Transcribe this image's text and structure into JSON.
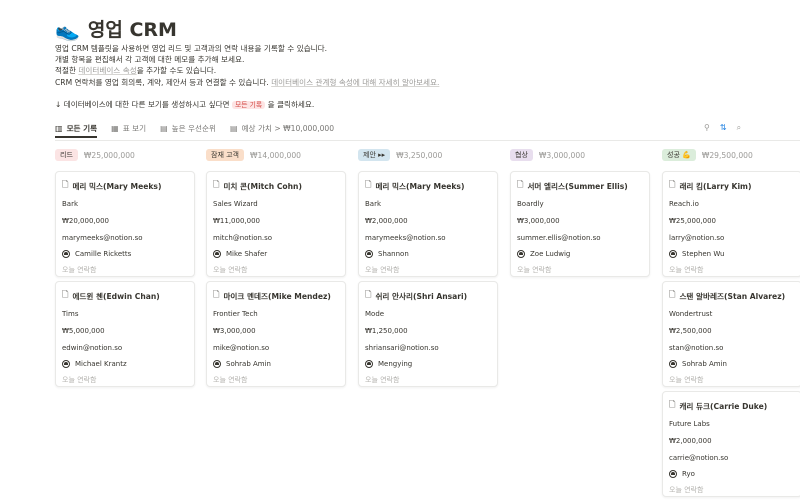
{
  "page": {
    "emoji": "👟",
    "title": "영업 CRM",
    "description_lines": [
      "영업 CRM 템플릿을 사용하면 영업 리드 및 고객과의 연락 내용을 기록할 수 있습니다.",
      "개별 항목을 편집해서 각 고객에 대한 메모를 추가해 보세요."
    ],
    "line3_pre": "적절한 ",
    "line3_link": "데이터베이스 속성",
    "line3_post": "을 추가할 수도 있습니다.",
    "line4_pre": "CRM 연락처를 영업 회의록, 계약, 제안서 등과 연결할 수 있습니다. ",
    "line4_link": "데이터베이스 관계형 속성에 대해 자세히 알아보세요.",
    "hint_pre": "↓ 데이터베이스에 대한 다른 보기를 생성하시고 싶다면 ",
    "hint_chip": "모든 기록",
    "hint_post": " 을 클릭하세요."
  },
  "views": [
    {
      "label": "모든 기록",
      "icon": "▥"
    },
    {
      "label": "표 보기",
      "icon": "▦"
    },
    {
      "label": "높은 우선순위",
      "icon": "▤"
    },
    {
      "label": "예상 가치 > ₩10,000,000",
      "icon": "▤"
    }
  ],
  "tools": {
    "filter": "⚲",
    "sort": "⇅",
    "search": "⌕"
  },
  "columns": [
    {
      "label": "리드",
      "color": "#fbe4e4",
      "total": "₩25,000,000",
      "cards": [
        {
          "name": "메리 믹스(Mary Meeks)",
          "company": "Bark",
          "value": "₩20,000,000",
          "email": "marymeeks@notion.so",
          "owner": "Camille Ricketts",
          "contact": "오늘 연락함"
        },
        {
          "name": "에드윈 첸(Edwin Chan)",
          "company": "Tims",
          "value": "₩5,000,000",
          "email": "edwin@notion.so",
          "owner": "Michael Krantz",
          "contact": "오늘 연락함"
        }
      ]
    },
    {
      "label": "잠재 고객",
      "color": "#fadec9",
      "total": "₩14,000,000",
      "cards": [
        {
          "name": "미치 콘(Mitch Cohn)",
          "company": "Sales Wizard",
          "value": "₩11,000,000",
          "email": "mitch@notion.so",
          "owner": "Mike Shafer",
          "contact": "오늘 연락함"
        },
        {
          "name": "마이크 멘데즈(Mike Mendez)",
          "company": "Frontier Tech",
          "value": "₩3,000,000",
          "email": "mike@notion.so",
          "owner": "Sohrab Amin",
          "contact": "오늘 연락함"
        }
      ]
    },
    {
      "label": "제안 ▸▸",
      "color": "#d3e5ef",
      "total": "₩3,250,000",
      "cards": [
        {
          "name": "메리 믹스(Mary Meeks)",
          "company": "Bark",
          "value": "₩2,000,000",
          "email": "marymeeks@notion.so",
          "owner": "Shannon",
          "contact": "오늘 연락함"
        },
        {
          "name": "쉬리 안사리(Shri Ansari)",
          "company": "Mode",
          "value": "₩1,250,000",
          "email": "shriansari@notion.so",
          "owner": "Mengying",
          "contact": "오늘 연락함"
        }
      ]
    },
    {
      "label": "협상",
      "color": "#e8deee",
      "total": "₩3,000,000",
      "cards": [
        {
          "name": "서머 엘리스(Summer Ellis)",
          "company": "Boardly",
          "value": "₩3,000,000",
          "email": "summer.ellis@notion.so",
          "owner": "Zoe Ludwig",
          "contact": "오늘 연락함"
        }
      ]
    },
    {
      "label": "성공 💪",
      "color": "#dbeddb",
      "total": "₩29,500,000",
      "cards": [
        {
          "name": "래리 킴(Larry Kim)",
          "company": "Reach.io",
          "value": "₩25,000,000",
          "email": "larry@notion.so",
          "owner": "Stephen Wu",
          "contact": "오늘 연락함"
        },
        {
          "name": "스탠 알바레즈(Stan Alvarez)",
          "company": "Wondertrust",
          "value": "₩2,500,000",
          "email": "stan@notion.so",
          "owner": "Sohrab Amin",
          "contact": "오늘 연락함"
        },
        {
          "name": "캐리 듀크(Carrie Duke)",
          "company": "Future Labs",
          "value": "₩2,000,000",
          "email": "carrie@notion.so",
          "owner": "Ryo",
          "contact": "오늘 연락함"
        }
      ]
    }
  ]
}
